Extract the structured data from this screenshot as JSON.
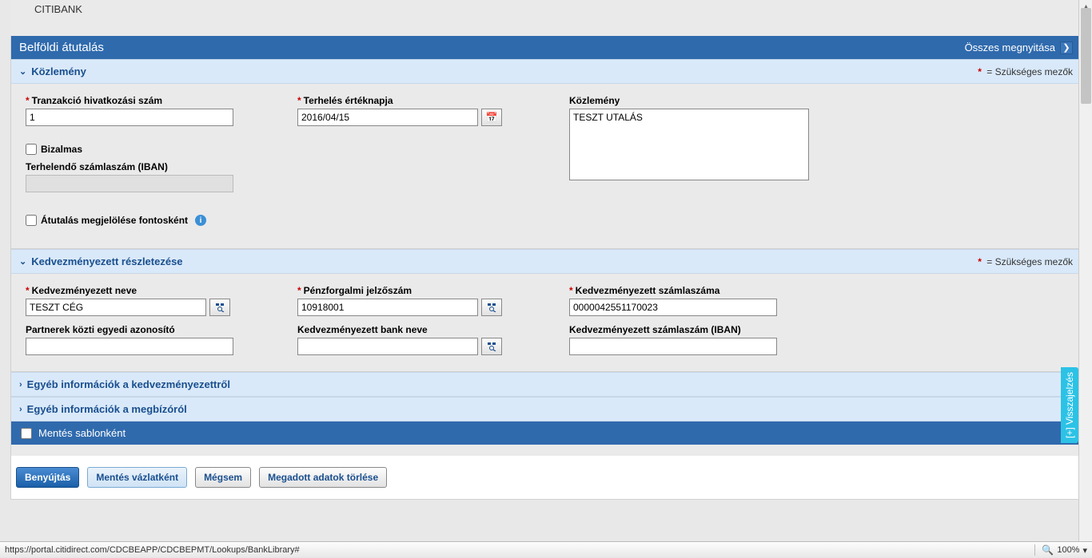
{
  "top": {
    "bank_name": "CITIBANK"
  },
  "title_bar": {
    "title": "Belföldi átutalás",
    "open_all": "Összes megnyitása"
  },
  "required_note": {
    "asterisk": "*",
    "text": " = Szükséges mezők"
  },
  "section1": {
    "title": "Közlemény",
    "tr_ref_label": "Tranzakció hivatkozási szám",
    "tr_ref_value": "1",
    "debit_date_label": "Terhelés értéknapja",
    "debit_date_value": "2016/04/15",
    "remarks_label": "Közlemény",
    "remarks_value": "TESZT UTALÁS",
    "confidential_label": "Bizalmas",
    "debit_iban_label": "Terhelendő számlaszám (IBAN)",
    "debit_iban_value": "",
    "mark_important_label": "Átutalás megjelölése fontosként"
  },
  "section2": {
    "title": "Kedvezményezett részletezése",
    "bene_name_label": "Kedvezményezett neve",
    "bene_name_value": "TESZT CÉG",
    "partner_id_label": "Partnerek közti egyedi azonosító",
    "partner_id_value": "",
    "bank_code_label": "Pénzforgalmi jelzőszám",
    "bank_code_value": "10918001",
    "bene_bank_name_label": "Kedvezményezett bank neve",
    "bene_bank_name_value": "",
    "bene_acct_label": "Kedvezményezett számlaszáma",
    "bene_acct_value": "0000042551170023",
    "bene_iban_label": "Kedvezményezett számlaszám (IBAN)",
    "bene_iban_value": ""
  },
  "section3": {
    "title": "Egyéb információk a kedvezményezettről"
  },
  "section4": {
    "title": "Egyéb információk a megbízóról"
  },
  "save_template": {
    "label": "Mentés sablonként"
  },
  "buttons": {
    "submit": "Benyújtás",
    "save_draft": "Mentés vázlatként",
    "cancel": "Mégsem",
    "clear": "Megadott adatok törlése"
  },
  "feedback_tab": "[+] Visszajelzés",
  "status": {
    "url": "https://portal.citidirect.com/CDCBEAPP/CDCBEPMT/Lookups/BankLibrary#",
    "zoom": "100%"
  }
}
